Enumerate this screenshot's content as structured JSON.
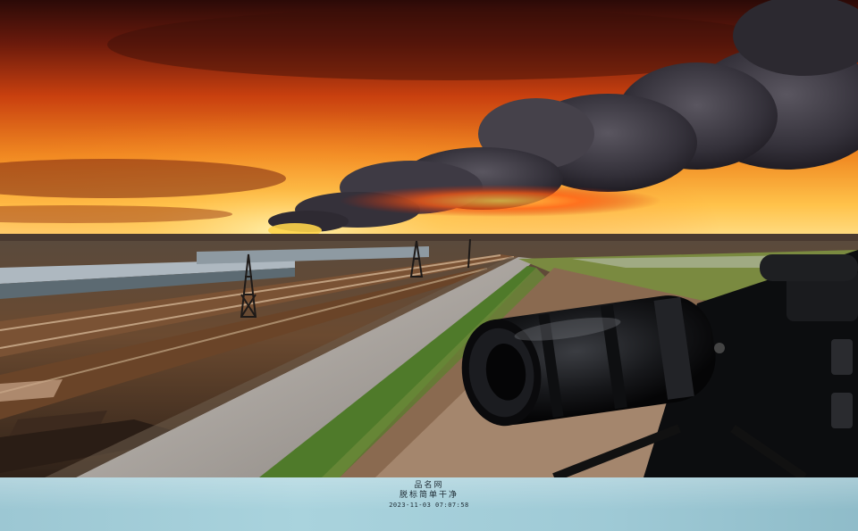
{
  "caption": {
    "site_name": "品名网",
    "subtitle": "脱标简单干净",
    "timestamp": "2023-11-03 07:07:58"
  },
  "scene": {
    "description_icons": [
      "smoke-plume",
      "sunset-sky",
      "railway-track",
      "gravel-road",
      "camera-lens",
      "power-pylon"
    ],
    "colors": {
      "sky_top": "#3a0d08",
      "sky_mid": "#e5531a",
      "sky_horizon": "#ffd36a",
      "smoke": "#3c3a40",
      "caption_bg": "#a9d3dd"
    }
  }
}
